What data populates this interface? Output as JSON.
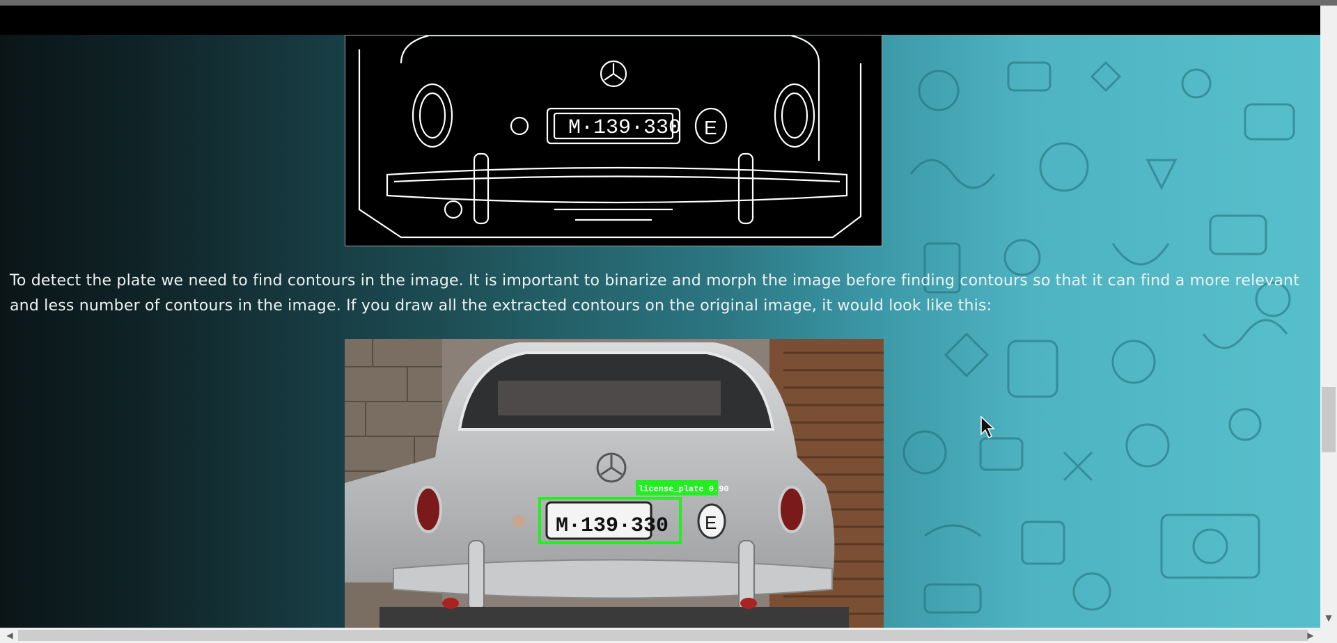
{
  "article": {
    "paragraph": "To detect the plate we need to find contours in the image. It is important to binarize and morph the image before finding contours so that it can find a more relevant and less number of contours in the image. If you draw all the extracted contours on the original image, it would look like this:"
  },
  "edge_image": {
    "plate_text": "M·139·330",
    "country_badge": "E"
  },
  "detection_image": {
    "plate_text": "M·139·330",
    "country_badge": "E",
    "detection_label": "license_plate 0.90",
    "box_color": "#22ee22"
  },
  "scrollbars": {
    "up_arrow": "▲",
    "down_arrow": "▼",
    "left_arrow": "◀",
    "right_arrow": "▶"
  }
}
